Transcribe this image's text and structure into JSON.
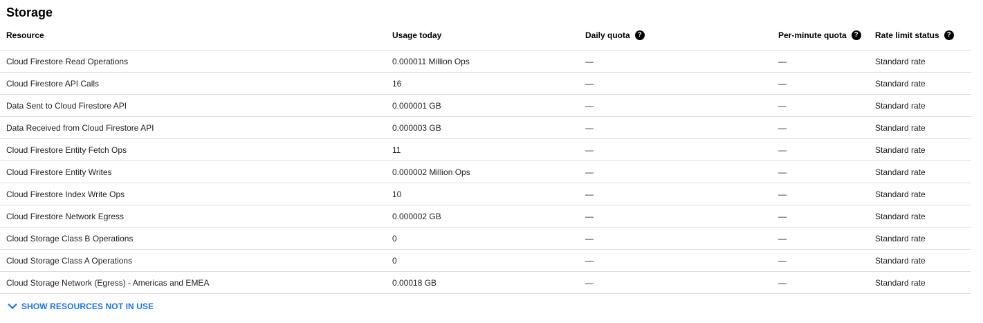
{
  "section": {
    "title": "Storage"
  },
  "table": {
    "headers": {
      "resource": "Resource",
      "usage": "Usage today",
      "daily_quota": "Daily quota",
      "per_minute_quota": "Per-minute quota",
      "rate_limit_status": "Rate limit status"
    },
    "help_icon": "help-icon",
    "rows": [
      {
        "resource": "Cloud Firestore Read Operations",
        "usage": "0.000011 Million Ops",
        "daily_quota": "—",
        "per_minute_quota": "—",
        "status": "Standard rate"
      },
      {
        "resource": "Cloud Firestore API Calls",
        "usage": "16",
        "daily_quota": "—",
        "per_minute_quota": "—",
        "status": "Standard rate"
      },
      {
        "resource": "Data Sent to Cloud Firestore API",
        "usage": "0.000001 GB",
        "daily_quota": "—",
        "per_minute_quota": "—",
        "status": "Standard rate"
      },
      {
        "resource": "Data Received from Cloud Firestore API",
        "usage": "0.000003 GB",
        "daily_quota": "—",
        "per_minute_quota": "—",
        "status": "Standard rate"
      },
      {
        "resource": "Cloud Firestore Entity Fetch Ops",
        "usage": "11",
        "daily_quota": "—",
        "per_minute_quota": "—",
        "status": "Standard rate"
      },
      {
        "resource": "Cloud Firestore Entity Writes",
        "usage": "0.000002 Million Ops",
        "daily_quota": "—",
        "per_minute_quota": "—",
        "status": "Standard rate"
      },
      {
        "resource": "Cloud Firestore Index Write Ops",
        "usage": "10",
        "daily_quota": "—",
        "per_minute_quota": "—",
        "status": "Standard rate"
      },
      {
        "resource": "Cloud Firestore Network Egress",
        "usage": "0.000002 GB",
        "daily_quota": "—",
        "per_minute_quota": "—",
        "status": "Standard rate"
      },
      {
        "resource": "Cloud Storage Class B Operations",
        "usage": "0",
        "daily_quota": "—",
        "per_minute_quota": "—",
        "status": "Standard rate"
      },
      {
        "resource": "Cloud Storage Class A Operations",
        "usage": "0",
        "daily_quota": "—",
        "per_minute_quota": "—",
        "status": "Standard rate"
      },
      {
        "resource": "Cloud Storage Network (Egress) - Americas and EMEA",
        "usage": "0.00018 GB",
        "daily_quota": "—",
        "per_minute_quota": "—",
        "status": "Standard rate"
      }
    ]
  },
  "footer": {
    "show_more_label": "SHOW RESOURCES NOT IN USE",
    "show_more_icon": "chevron-down-icon"
  },
  "colors": {
    "link": "#1a73e8",
    "divider": "#dadce0",
    "text": "#202124"
  }
}
